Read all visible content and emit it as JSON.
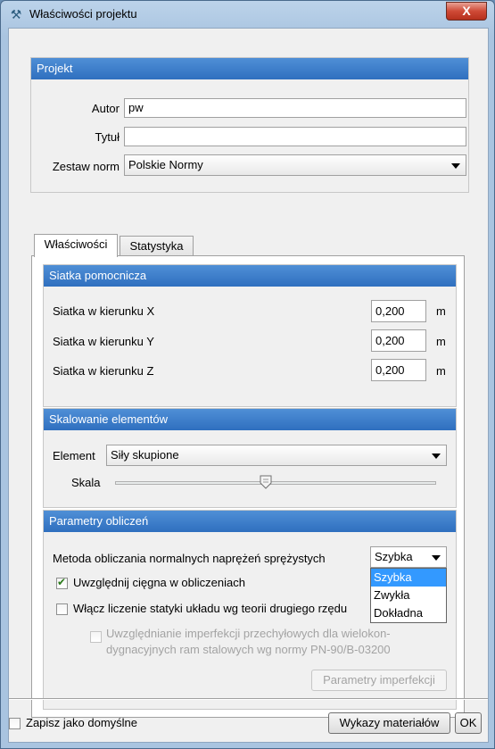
{
  "window": {
    "title": "Właściwości projektu",
    "close_glyph": "X"
  },
  "project": {
    "header": "Projekt",
    "author_label": "Autor",
    "author_value": "pw",
    "title_label": "Tytuł",
    "title_value": "",
    "norm_label": "Zestaw norm",
    "norm_value": "Polskie Normy"
  },
  "tabs": [
    {
      "label": "Właściwości",
      "active": true
    },
    {
      "label": "Statystyka",
      "active": false
    }
  ],
  "grid": {
    "header": "Siatka pomocnicza",
    "rows": [
      {
        "label": "Siatka w kierunku X",
        "value": "0,200",
        "unit": "m"
      },
      {
        "label": "Siatka w kierunku Y",
        "value": "0,200",
        "unit": "m"
      },
      {
        "label": "Siatka w kierunku Z",
        "value": "0,200",
        "unit": "m"
      }
    ]
  },
  "scaling": {
    "header": "Skalowanie elementów",
    "element_label": "Element",
    "element_value": "Siły skupione",
    "scale_label": "Skala",
    "scale_level": 0.47
  },
  "calc": {
    "header": "Parametry obliczeń",
    "method_label": "Metoda obliczania normalnych naprężeń sprężystych",
    "method_value": "Szybka",
    "method_options": [
      "Szybka",
      "Zwykła",
      "Dokładna"
    ],
    "cables_label": "Uwzględnij cięgna w obliczeniach",
    "cables_checked": true,
    "second_order_label": "Włącz liczenie statyki układu wg teorii drugiego rzędu",
    "second_order_checked": false,
    "imperfection_line1": "Uwzględnianie imperfekcji przechyłowych dla wielokon-",
    "imperfection_line2": "dygnacyjnych ram stalowych wg normy PN-90/B-03200",
    "imperfection_button": "Parametry imperfekcji"
  },
  "footer": {
    "save_default_label": "Zapisz jako domyślne",
    "materials_button": "Wykazy materiałów",
    "ok_button": "OK"
  }
}
